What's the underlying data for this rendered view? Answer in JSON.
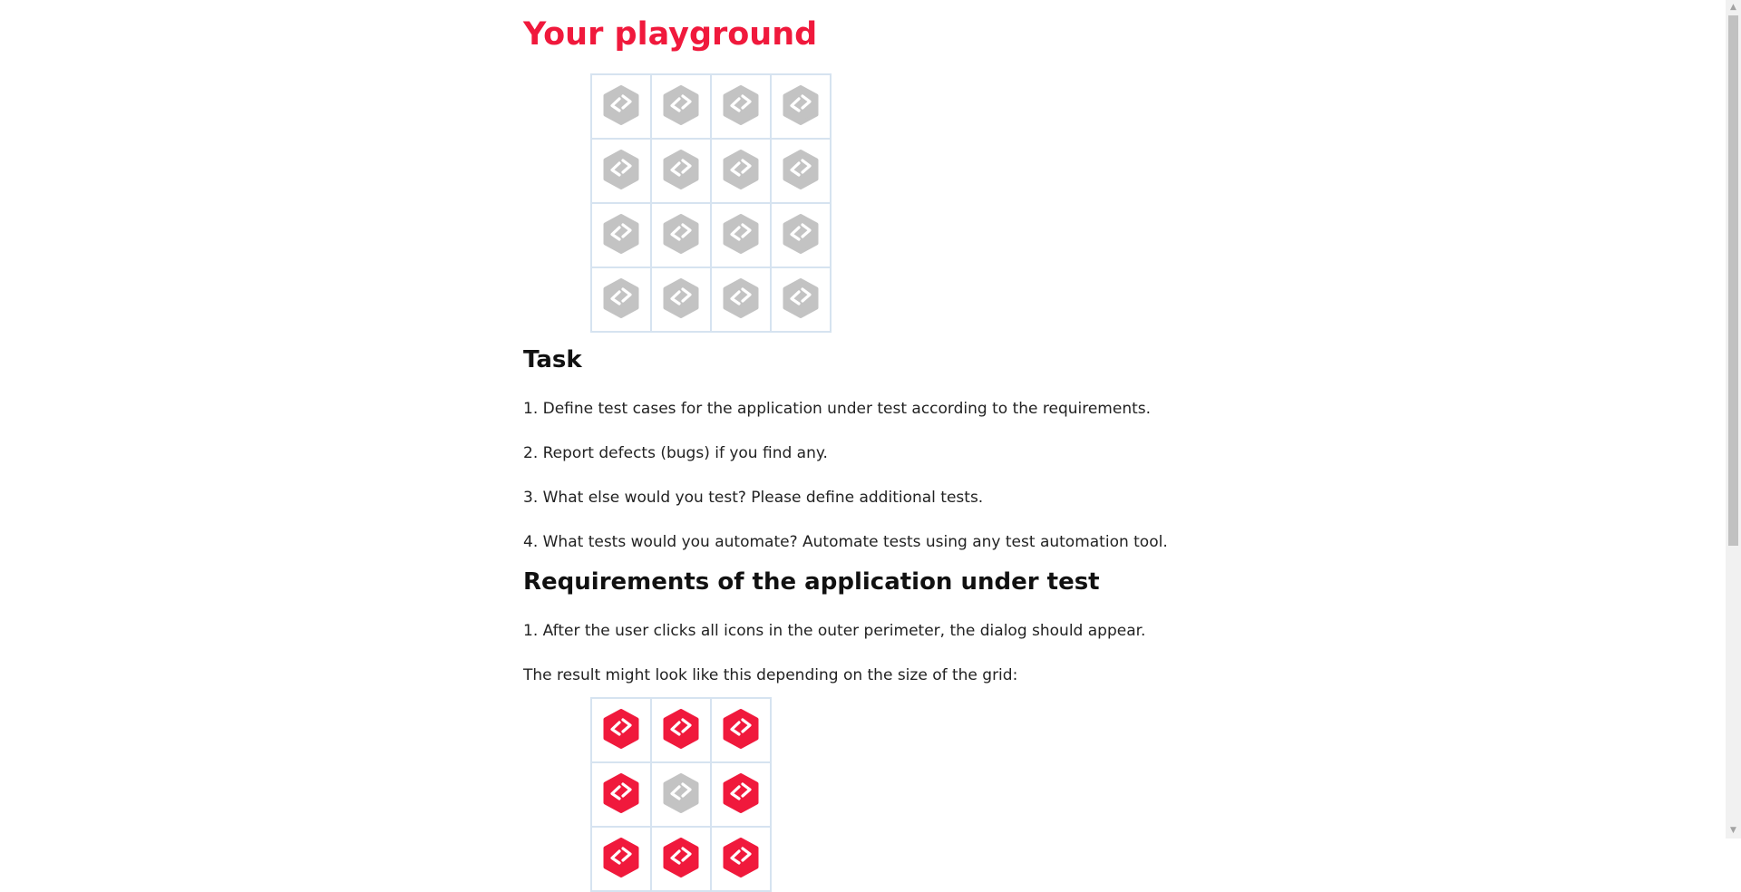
{
  "page": {
    "title": "Your playground"
  },
  "playground": {
    "rows": 4,
    "cols": 4,
    "icon": "code-hexagon-icon",
    "states": [
      [
        "inactive",
        "inactive",
        "inactive",
        "inactive"
      ],
      [
        "inactive",
        "inactive",
        "inactive",
        "inactive"
      ],
      [
        "inactive",
        "inactive",
        "inactive",
        "inactive"
      ],
      [
        "inactive",
        "inactive",
        "inactive",
        "inactive"
      ]
    ]
  },
  "task": {
    "heading": "Task",
    "items": [
      "1. Define test cases for the application under test according to the requirements.",
      "2. Report defects (bugs) if you find any.",
      "3. What else would you test? Please define additional tests.",
      "4. What tests would you automate? Automate tests using any test automation tool."
    ]
  },
  "requirements": {
    "heading": "Requirements of the application under test",
    "items": [
      "1. After the user clicks all icons in the outer perimeter, the dialog should appear.",
      "The result might look like this depending on the size of the grid:"
    ]
  },
  "example": {
    "rows": 3,
    "cols": 3,
    "icon": "code-hexagon-icon",
    "states": [
      [
        "active",
        "active",
        "active"
      ],
      [
        "active",
        "inactive",
        "active"
      ],
      [
        "active",
        "active",
        "active"
      ]
    ]
  },
  "colors": {
    "accent": "#f0193c",
    "inactive": "#c3c3c3",
    "grid_border": "#d6e3f0"
  }
}
